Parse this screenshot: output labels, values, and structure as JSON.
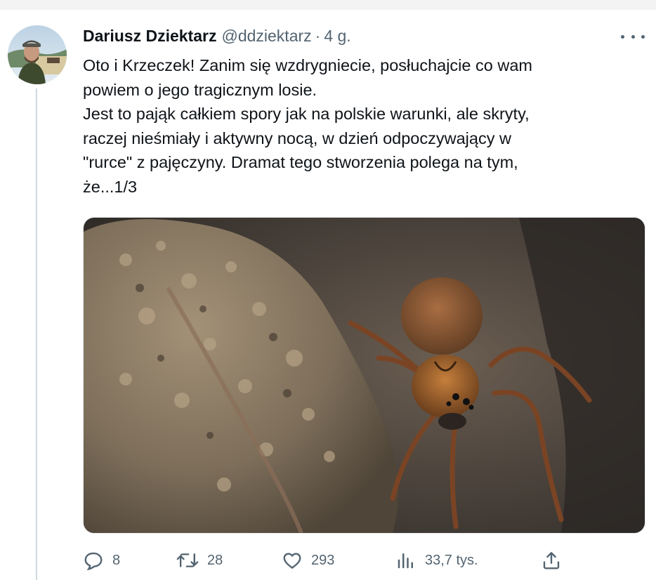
{
  "tweet": {
    "author_name": "Dariusz Dziektarz",
    "handle": "@ddziektarz",
    "separator": "·",
    "time": "4 g.",
    "text": "Oto i Krzeczek! Zanim się wzdrygniecie, posłuchajcie co wam\npowiem o jego tragicznym losie.\nJest to pająk całkiem spory jak na polskie warunki, ale skryty,\nraczej nieśmiały i aktywny nocą, w dzień odpoczywający w\n\"rurce\" z pajęczyny. Dramat tego stworzenia polega na tym,\nże...1/3"
  },
  "actions": {
    "replies": "8",
    "retweets": "28",
    "likes": "293",
    "views": "33,7 tys."
  },
  "icons": {
    "more": "more-horizontal-icon",
    "reply": "reply-icon",
    "retweet": "retweet-icon",
    "like": "heart-icon",
    "views": "analytics-icon",
    "share": "share-icon"
  },
  "colors": {
    "text": "#0f1419",
    "secondary": "#536471",
    "thread_line": "#cfd9de"
  }
}
